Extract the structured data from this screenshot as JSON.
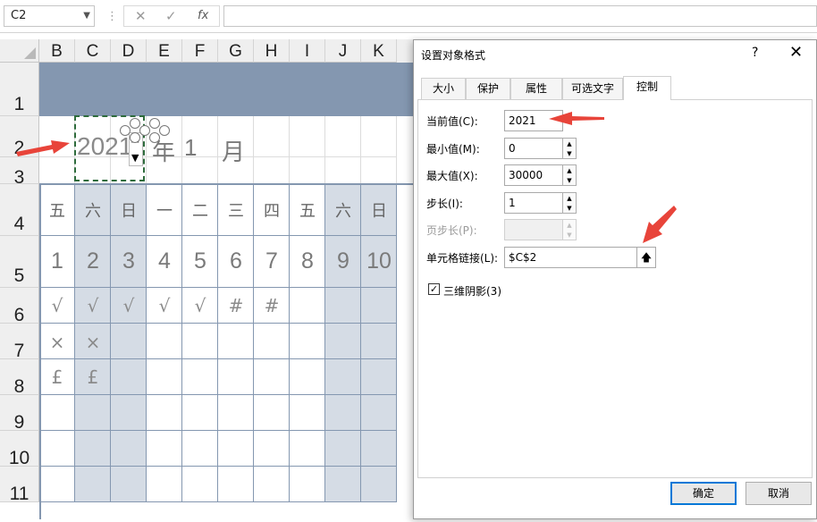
{
  "formula_bar": {
    "name_box": "C2",
    "cancel_icon": "✕",
    "enter_icon": "✓",
    "fx_label": "fx"
  },
  "columns": [
    "B",
    "C",
    "D",
    "E",
    "F",
    "G",
    "H",
    "I",
    "J",
    "K"
  ],
  "rows": [
    "1",
    "2",
    "3",
    "4",
    "5",
    "6",
    "7",
    "8",
    "9",
    "10",
    "11"
  ],
  "sheet": {
    "year": "2021",
    "year_label": "年",
    "month": "1",
    "month_label": "月",
    "weekdays": [
      "五",
      "六",
      "日",
      "一",
      "二",
      "三",
      "四",
      "五",
      "六",
      "日"
    ],
    "dates": [
      "1",
      "2",
      "3",
      "4",
      "5",
      "6",
      "7",
      "8",
      "9",
      "10"
    ],
    "row6": [
      "√",
      "√",
      "√",
      "√",
      "√",
      "#",
      "#",
      "",
      "",
      ""
    ],
    "row7": [
      "×",
      "×"
    ],
    "row8": [
      "£",
      "£"
    ],
    "header_band_color": "#8497b0",
    "weekend_shade_color": "#d5dce5"
  },
  "dialog": {
    "title": "设置对象格式",
    "help": "?",
    "close": "✕",
    "tabs": [
      "大小",
      "保护",
      "属性",
      "可选文字",
      "控制"
    ],
    "active_tab": "控制",
    "fields": {
      "current_label": "当前值(C):",
      "current_value": "2021",
      "min_label": "最小值(M):",
      "min_value": "0",
      "max_label": "最大值(X):",
      "max_value": "30000",
      "step_label": "步长(I):",
      "step_value": "1",
      "page_label": "页步长(P):",
      "page_value": "",
      "link_label": "单元格链接(L):",
      "link_value": "$C$2"
    },
    "checkbox_label": "三维阴影(3)",
    "checkbox_checked": true,
    "ok": "确定",
    "cancel": "取消"
  }
}
